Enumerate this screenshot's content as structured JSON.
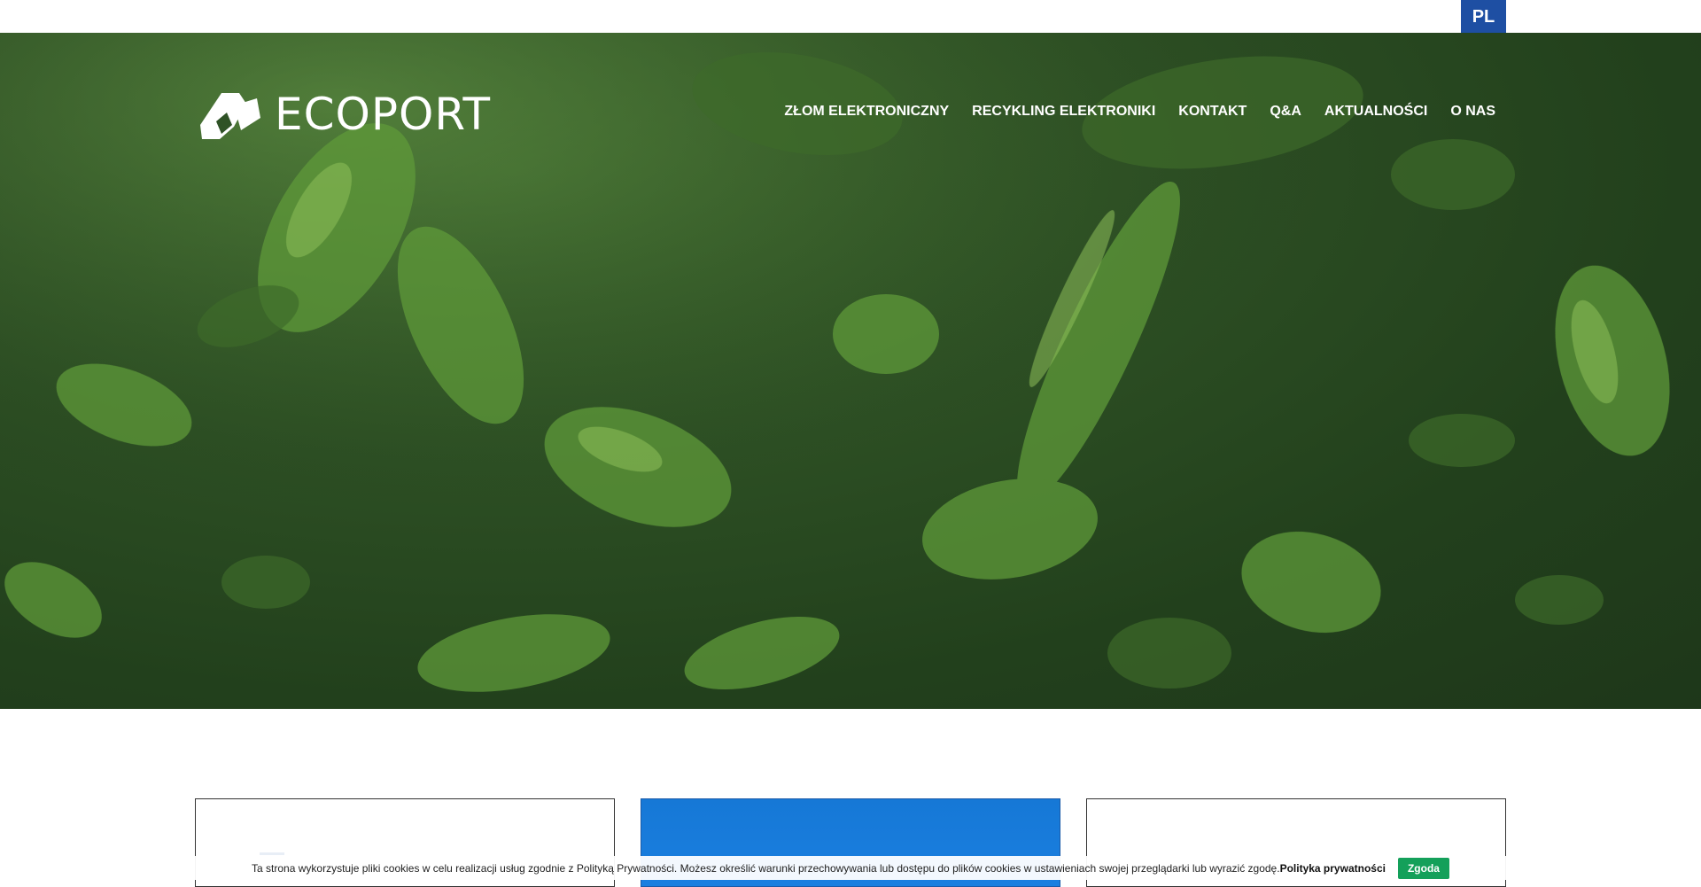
{
  "language": "PL",
  "brand": {
    "name": "ECOPORT"
  },
  "nav": [
    "ZŁOM ELEKTRONICZNY",
    "RECYKLING ELEKTRONIKI",
    "KONTAKT",
    "Q&A",
    "AKTUALNOŚCI",
    "O NAS"
  ],
  "cookie": {
    "text": "Ta strona wykorzystuje pliki cookies w celu realizacji usług zgodnie z Polityką Prywatności. Możesz określić warunki przechowywania lub dostępu do plików cookies w ustawieniach swojej przeglądarki lub wyrazić zgodę.",
    "policy_link": "Polityka prywatności",
    "accept": "Zgoda"
  },
  "colors": {
    "lang_badge": "#1e4fa3",
    "hero_dark": "#22401c",
    "accept_button": "#14a05a",
    "card_highlight": "#1678d6"
  }
}
